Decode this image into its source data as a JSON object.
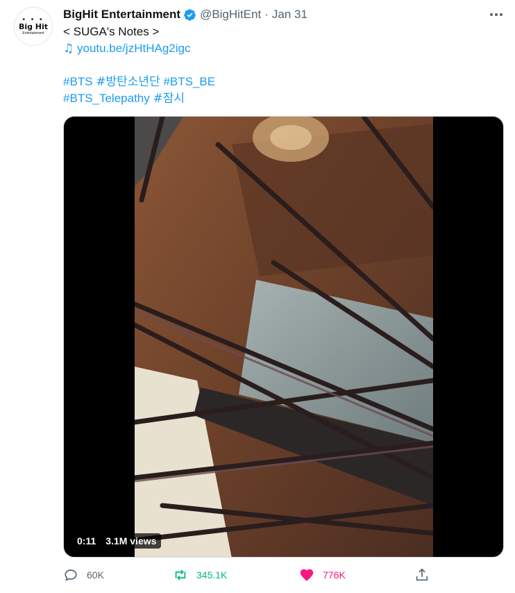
{
  "avatar": {
    "line1": "Big Hit",
    "line2": "Entertainment"
  },
  "tweet": {
    "display_name": "BigHit Entertainment",
    "handle": "@BigHitEnt",
    "separator": "·",
    "date": "Jan 31",
    "lines": {
      "title": "< SUGA's Notes >",
      "music_icon": "♫",
      "link": "youtu.be/jzHtHAg2igc"
    },
    "hashtags_line1": [
      "#BTS",
      "#방탄소년단",
      "#BTS_BE"
    ],
    "hashtags_line2": [
      "#BTS_Telepathy",
      "#잠시"
    ]
  },
  "video": {
    "time": "0:11",
    "views": "3.1M views"
  },
  "actions": {
    "reply_count": "60K",
    "retweet_count": "345.1K",
    "like_count": "776K"
  },
  "colors": {
    "link": "#1d9bf0",
    "muted": "#536471",
    "retweet": "#00ba7c",
    "like": "#f91880",
    "verified": "#1d9bf0"
  },
  "icons": [
    "verified-badge-icon",
    "more-icon",
    "music-note-icon",
    "reply-icon",
    "retweet-icon",
    "like-icon",
    "share-icon"
  ]
}
